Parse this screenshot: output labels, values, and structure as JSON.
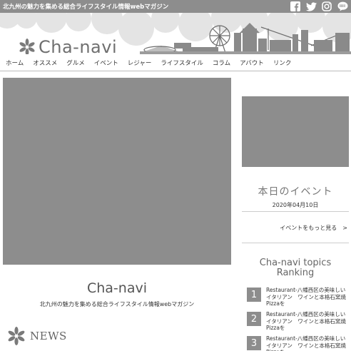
{
  "site": {
    "tagline": "北九州の魅力を集める総合ライフスタイル情報webマガジン",
    "logo_text": "Cha-navi"
  },
  "social": [
    {
      "name": "facebook-icon"
    },
    {
      "name": "twitter-icon"
    },
    {
      "name": "instagram-icon"
    },
    {
      "name": "line-icon"
    }
  ],
  "nav": [
    "ホーム",
    "オススメ",
    "グルメ",
    "イベント",
    "レジャー",
    "ライフスタイル",
    "コラム",
    "アバウト",
    "リンク"
  ],
  "hero": {
    "title": "Cha-navi",
    "subtitle": "北九州の魅力を集める総合ライフスタイル情報webマガジン"
  },
  "news": {
    "heading": "NEWS"
  },
  "event": {
    "title": "本日のイベント",
    "date": "2020年04月10日",
    "more_link": "イベントをもっと見る　>"
  },
  "topics": {
    "title_line1": "Cha-navi topics",
    "title_line2": "Ranking",
    "items": [
      {
        "rank": "1",
        "text": "Restaurant-八幡西区の美味しいイタリアン　ワインと本格石窯焼Pizzaを"
      },
      {
        "rank": "2",
        "text": "Restaurant-八幡西区の美味しいイタリアン　ワインと本格石窯焼Pizzaを"
      },
      {
        "rank": "3",
        "text": "Restaurant-八幡西区の美味しいイタリアン　ワインと本格石窯焼Pizzaを"
      }
    ]
  },
  "colors": {
    "placeholder_gray": "#8d8d8d",
    "bubble_gray": "#e4e4e4"
  }
}
